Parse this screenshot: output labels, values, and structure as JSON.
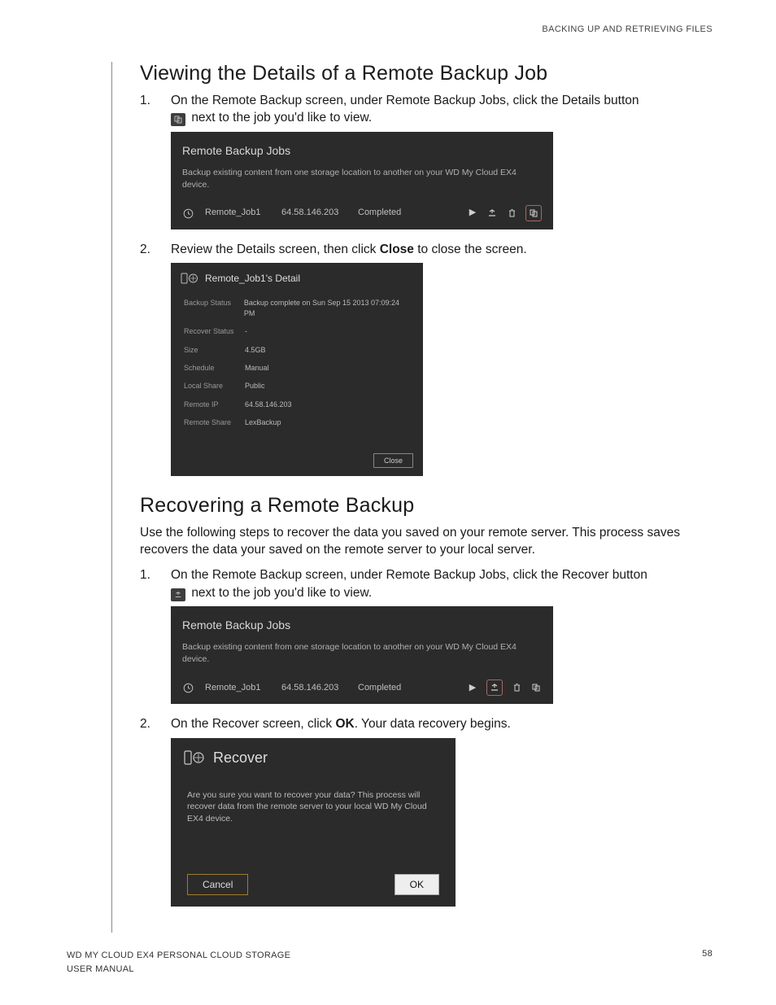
{
  "runningHead": "BACKING UP AND RETRIEVING FILES",
  "section1": {
    "heading": "Viewing the Details of a Remote Backup Job",
    "step1a": "On the Remote Backup screen, under Remote Backup Jobs, click the Details button",
    "step1b": " next to the job you'd like to view.",
    "step2a": "Review the Details screen, then click ",
    "step2bold": "Close",
    "step2b": " to close the screen."
  },
  "jobsPanel": {
    "title": "Remote Backup Jobs",
    "subtitle": "Backup existing content from one storage location to another on your WD My Cloud EX4 device.",
    "job": {
      "name": "Remote_Job1",
      "ip": "64.58.146.203",
      "status": "Completed"
    }
  },
  "detailPanel": {
    "title": "Remote_Job1's Detail",
    "rows": [
      {
        "k": "Backup Status",
        "v": "Backup complete on Sun Sep 15 2013 07:09:24 PM"
      },
      {
        "k": "Recover Status",
        "v": "-"
      },
      {
        "k": "Size",
        "v": "4.5GB"
      },
      {
        "k": "Schedule",
        "v": "Manual"
      },
      {
        "k": "Local Share",
        "v": "Public"
      },
      {
        "k": "Remote IP",
        "v": "64.58.146.203"
      },
      {
        "k": "Remote Share",
        "v": "LexBackup"
      }
    ],
    "close": "Close"
  },
  "section2": {
    "heading": "Recovering a Remote Backup",
    "intro": "Use the following steps to recover the data you saved on your remote server. This process saves recovers the data your saved on the remote server to your local server.",
    "step1a": "On the Remote Backup screen, under Remote Backup Jobs, click the Recover button",
    "step1b": " next to the job you'd like to view.",
    "step2a": "On the Recover screen, click ",
    "step2bold": "OK",
    "step2b": ". Your data recovery begins."
  },
  "recoverDialog": {
    "title": "Recover",
    "body": "Are you sure you want to recover your data? This process will recover data from the remote server to your local WD My Cloud EX4 device.",
    "cancel": "Cancel",
    "ok": "OK"
  },
  "footer": {
    "line1": "WD MY CLOUD EX4 PERSONAL CLOUD STORAGE",
    "line2": "USER MANUAL",
    "page": "58"
  }
}
